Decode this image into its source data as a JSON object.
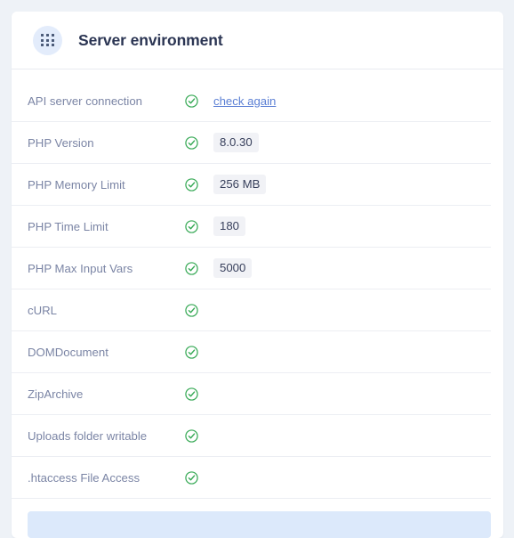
{
  "header": {
    "title": "Server environment",
    "icon": "grid-dots-icon"
  },
  "rows": [
    {
      "label": "API server connection",
      "status": "check-circle-icon",
      "value": "",
      "link": "check again"
    },
    {
      "label": "PHP Version",
      "status": "check-circle-icon",
      "value": "8.0.30",
      "link": ""
    },
    {
      "label": "PHP Memory Limit",
      "status": "check-circle-icon",
      "value": "256 MB",
      "link": ""
    },
    {
      "label": "PHP Time Limit",
      "status": "check-circle-icon",
      "value": "180",
      "link": ""
    },
    {
      "label": "PHP Max Input Vars",
      "status": "check-circle-icon",
      "value": "5000",
      "link": ""
    },
    {
      "label": "cURL",
      "status": "check-circle-icon",
      "value": "",
      "link": ""
    },
    {
      "label": "DOMDocument",
      "status": "check-circle-icon",
      "value": "",
      "link": ""
    },
    {
      "label": "ZipArchive",
      "status": "check-circle-icon",
      "value": "",
      "link": ""
    },
    {
      "label": "Uploads folder writable",
      "status": "check-circle-icon",
      "value": "",
      "link": ""
    },
    {
      "label": ".htaccess File Access",
      "status": "check-circle-icon",
      "value": "",
      "link": ""
    }
  ],
  "notice": {
    "text": ""
  },
  "colors": {
    "page_background": "#eef2f7",
    "card_background": "#ffffff",
    "title": "#2b3553",
    "label": "#7b85a5",
    "status_ok": "#34a853",
    "link": "#5b7fd4",
    "chip_background": "#f1f2f6",
    "chip_text": "#38405c",
    "header_icon_background": "#e3ecfb",
    "notice_background": "#dce9fb"
  }
}
